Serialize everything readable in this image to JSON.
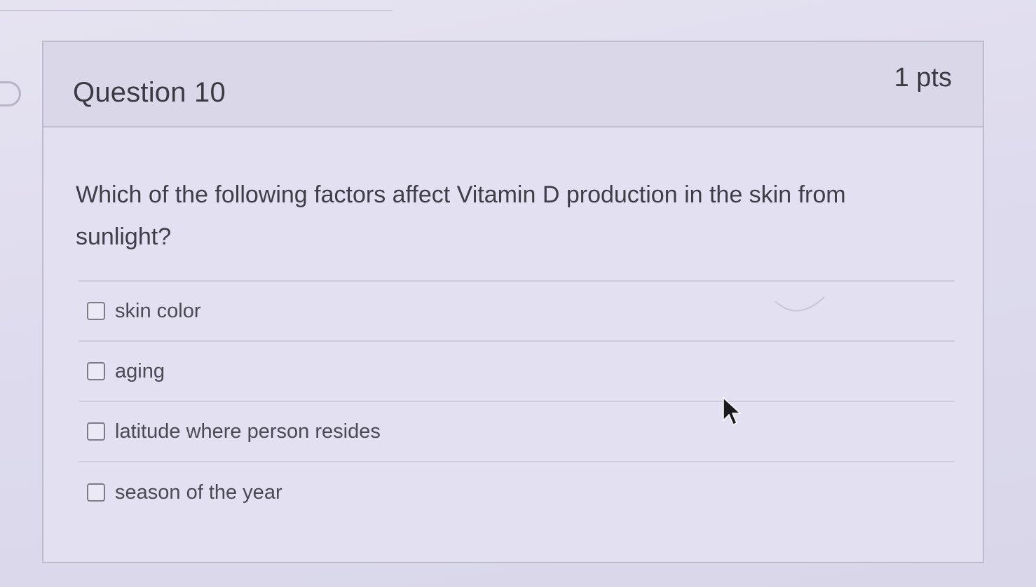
{
  "question": {
    "title": "Question 10",
    "points": "1 pts",
    "text": "Which of the following factors affect Vitamin D production in the skin from sunlight?"
  },
  "answers": [
    {
      "label": "skin color",
      "checked": false
    },
    {
      "label": "aging",
      "checked": false
    },
    {
      "label": "latitude where person resides",
      "checked": false
    },
    {
      "label": "season of the year",
      "checked": false
    }
  ],
  "icons": {
    "flag": "flag-marker-icon",
    "cursor": "mouse-pointer-icon",
    "checkbox": "checkbox-icon"
  },
  "colors": {
    "background": "#dedbee",
    "header": "#dad7e8",
    "text": "#3b3a44",
    "border": "#bdbacb"
  }
}
